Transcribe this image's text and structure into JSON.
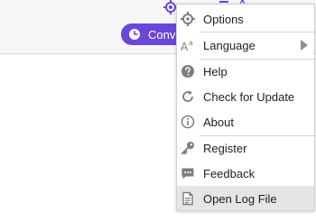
{
  "window": {
    "convert_button_label": "Convert"
  },
  "menu": {
    "items": [
      {
        "label": "Options",
        "icon": "gear-icon",
        "has_submenu": false,
        "highlighted": false
      },
      {
        "label": "Language",
        "icon": "language-icon",
        "has_submenu": true,
        "highlighted": false
      },
      {
        "label": "Help",
        "icon": "help-icon",
        "has_submenu": false,
        "highlighted": false
      },
      {
        "label": "Check for Update",
        "icon": "refresh-icon",
        "has_submenu": false,
        "highlighted": false
      },
      {
        "label": "About",
        "icon": "info-icon",
        "has_submenu": false,
        "highlighted": false
      },
      {
        "label": "Register",
        "icon": "key-icon",
        "has_submenu": false,
        "highlighted": false
      },
      {
        "label": "Feedback",
        "icon": "chat-icon",
        "has_submenu": false,
        "highlighted": false
      },
      {
        "label": "Open Log File",
        "icon": "log-file-icon",
        "has_submenu": false,
        "highlighted": true
      }
    ]
  },
  "colors": {
    "accent": "#6a47d8",
    "menu_icon": "#7d7d82",
    "highlight": "#e5e5e8"
  }
}
